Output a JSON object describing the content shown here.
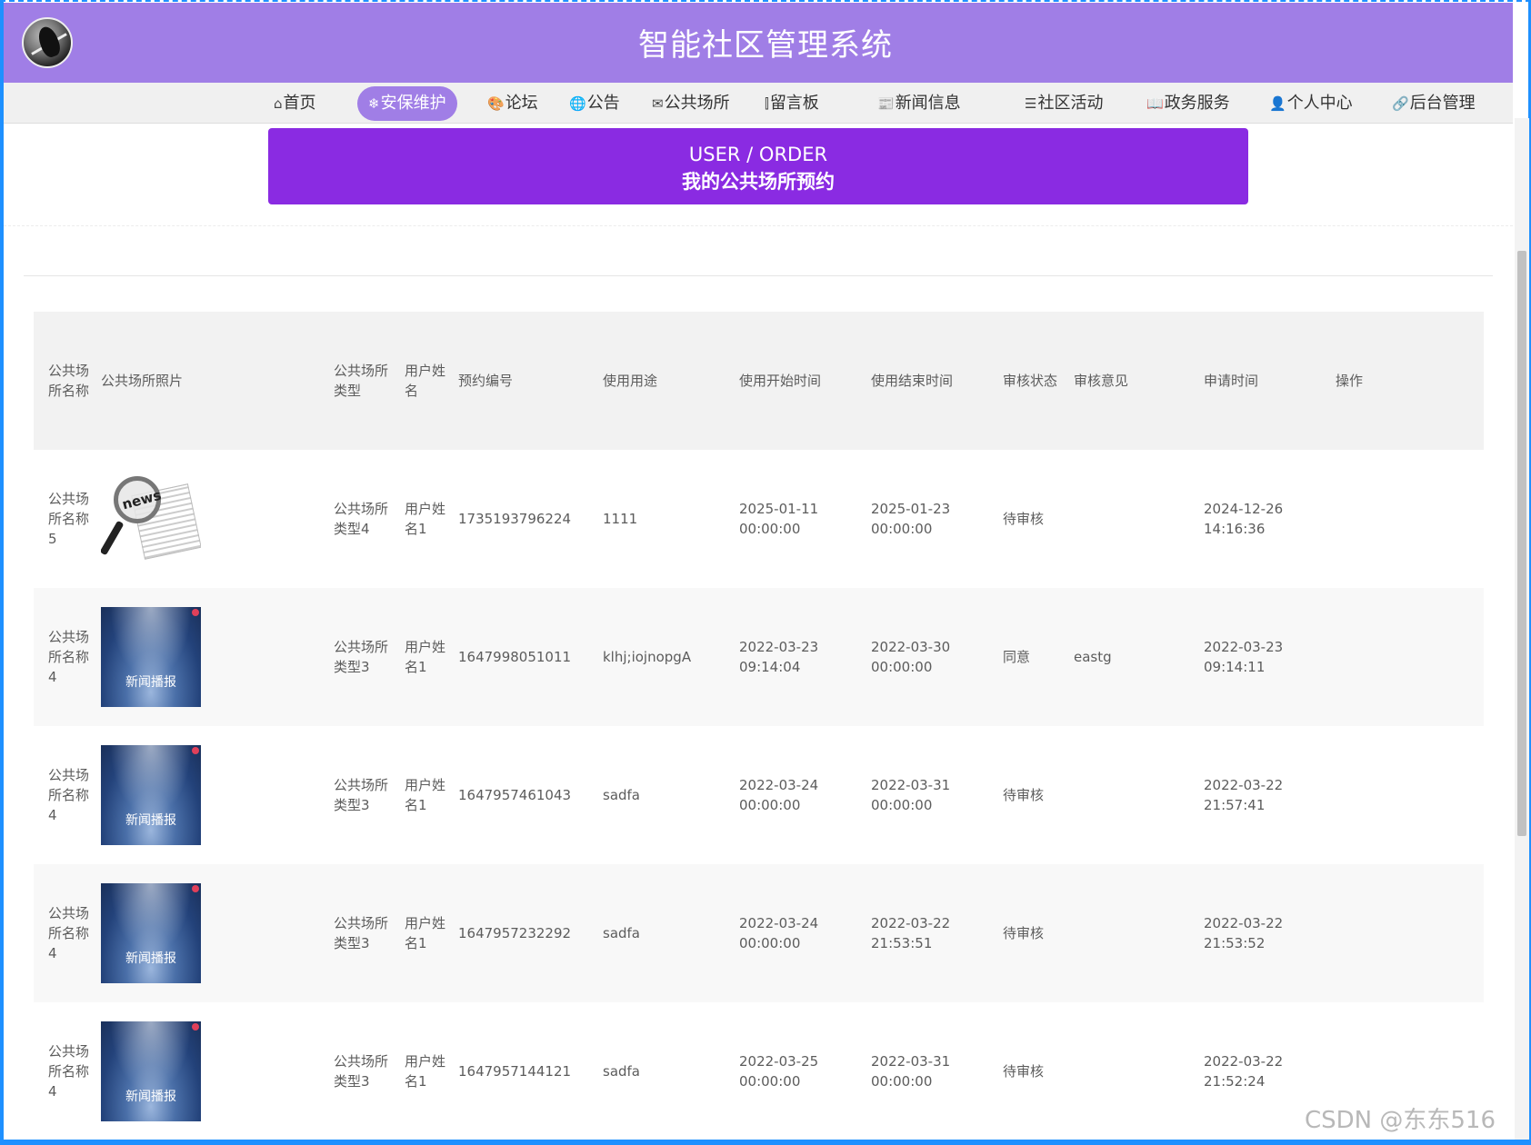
{
  "header": {
    "title": "智能社区管理系统"
  },
  "nav": {
    "items": [
      {
        "icon": "⌂",
        "label": "首页"
      },
      {
        "icon": "❄",
        "label": "安保维护",
        "active": true
      },
      {
        "icon": "🎨",
        "label": "论坛"
      },
      {
        "icon": "🌐",
        "label": "公告"
      },
      {
        "icon": "✉",
        "label": "公共场所"
      },
      {
        "icon": "⫿",
        "label": "留言板"
      },
      {
        "icon": "📰",
        "label": "新闻信息"
      },
      {
        "icon": "☰",
        "label": "社区活动"
      },
      {
        "icon": "📖",
        "label": "政务服务"
      },
      {
        "icon": "👤",
        "label": "个人中心"
      },
      {
        "icon": "🔗",
        "label": "后台管理"
      }
    ]
  },
  "banner": {
    "en": "USER / ORDER",
    "cn": "我的公共场所预约"
  },
  "table": {
    "headers": [
      "公共场所名称",
      "公共场所照片",
      "公共场所类型",
      "用户姓名",
      "预约编号",
      "使用用途",
      "使用开始时间",
      "使用结束时间",
      "审核状态",
      "审核意见",
      "申请时间",
      "操作"
    ],
    "image_caption": "新闻播报",
    "news_word": "news",
    "rows": [
      {
        "name": "公共场所名称5",
        "image": "news",
        "type": "公共场所类型4",
        "user": "用户姓名1",
        "no": "1735193796224",
        "purpose": "1111",
        "start_date": "2025-01-11",
        "start_time": "00:00:00",
        "end_date": "2025-01-23",
        "end_time": "00:00:00",
        "status": "待审核",
        "opinion": "",
        "apply_date": "2024-12-26",
        "apply_time": "14:16:36"
      },
      {
        "name": "公共场所名称4",
        "image": "broadcast",
        "type": "公共场所类型3",
        "user": "用户姓名1",
        "no": "1647998051011",
        "purpose": "klhj;iojnopgA",
        "start_date": "2022-03-23",
        "start_time": "09:14:04",
        "end_date": "2022-03-30",
        "end_time": "00:00:00",
        "status": "同意",
        "opinion": "eastg",
        "apply_date": "2022-03-23",
        "apply_time": "09:14:11"
      },
      {
        "name": "公共场所名称4",
        "image": "broadcast",
        "type": "公共场所类型3",
        "user": "用户姓名1",
        "no": "1647957461043",
        "purpose": "sadfa",
        "start_date": "2022-03-24",
        "start_time": "00:00:00",
        "end_date": "2022-03-31",
        "end_time": "00:00:00",
        "status": "待审核",
        "opinion": "",
        "apply_date": "2022-03-22",
        "apply_time": "21:57:41"
      },
      {
        "name": "公共场所名称4",
        "image": "broadcast",
        "type": "公共场所类型3",
        "user": "用户姓名1",
        "no": "1647957232292",
        "purpose": "sadfa",
        "start_date": "2022-03-24",
        "start_time": "00:00:00",
        "end_date": "2022-03-22",
        "end_time": "21:53:51",
        "status": "待审核",
        "opinion": "",
        "apply_date": "2022-03-22",
        "apply_time": "21:53:52"
      },
      {
        "name": "公共场所名称4",
        "image": "broadcast",
        "type": "公共场所类型3",
        "user": "用户姓名1",
        "no": "1647957144121",
        "purpose": "sadfa",
        "start_date": "2022-03-25",
        "start_time": "00:00:00",
        "end_date": "2022-03-31",
        "end_time": "00:00:00",
        "status": "待审核",
        "opinion": "",
        "apply_date": "2022-03-22",
        "apply_time": "21:52:24"
      }
    ]
  },
  "watermark": "CSDN @东东516",
  "colors": {
    "header": "#a07ee6",
    "banner": "#8a2be2",
    "frame": "#1e90ff"
  }
}
